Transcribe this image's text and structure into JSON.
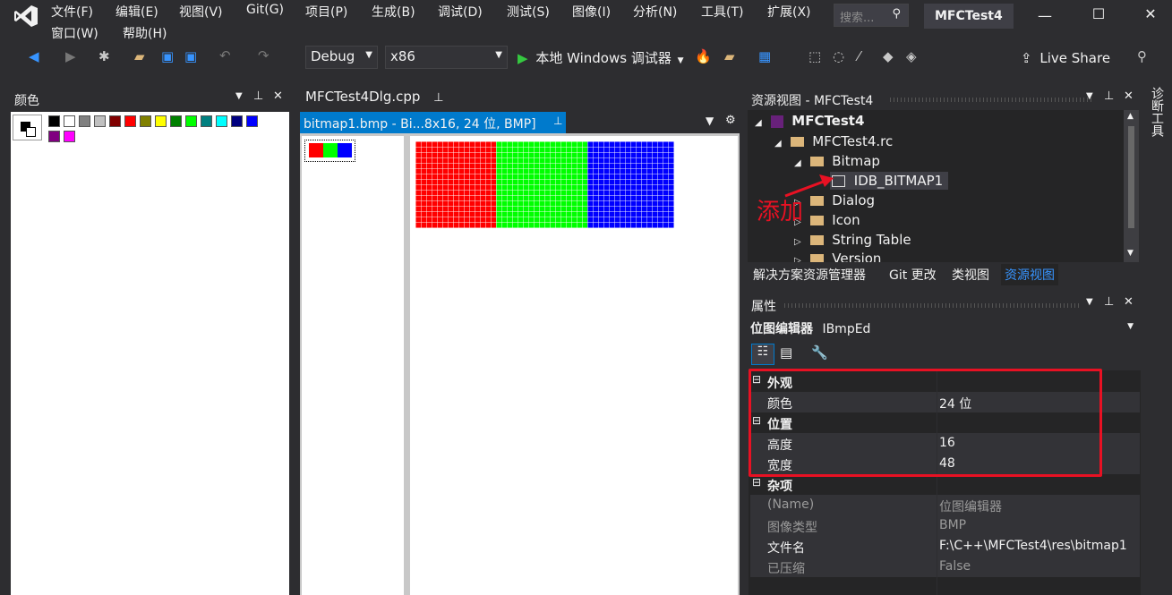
{
  "menu": {
    "items": [
      "文件(F)",
      "编辑(E)",
      "视图(V)",
      "Git(G)",
      "项目(P)",
      "生成(B)",
      "调试(D)",
      "测试(S)",
      "图像(I)",
      "分析(N)",
      "工具(T)",
      "扩展(X)"
    ],
    "items2": [
      "窗口(W)",
      "帮助(H)"
    ],
    "search_placeholder": "搜索...",
    "solution_title": "MFCTest4"
  },
  "toolbar": {
    "config": "Debug",
    "platform": "x86",
    "run_label": "本地 Windows 调试器",
    "live_share": "Live Share"
  },
  "colors_panel": {
    "title": "颜色",
    "palette": [
      "#000000",
      "#ffffff",
      "#808080",
      "#c0c0c0",
      "#800000",
      "#ff0000",
      "#808000",
      "#ffff00",
      "#008000",
      "#00ff00",
      "#008080",
      "#00ffff",
      "#000080",
      "#0000ff",
      "#800080",
      "#ff00ff"
    ]
  },
  "editor": {
    "tab_pinned": "MFCTest4Dlg.cpp",
    "tab_active": "bitmap1.bmp - Bi...8x16, 24 位, BMP]",
    "bitmap_colors": [
      "#ff0000",
      "#00ff00",
      "#0000ff"
    ]
  },
  "resource_view": {
    "title": "资源视图 - MFCTest4",
    "tree": {
      "root": "MFCTest4",
      "rc": "MFCTest4.rc",
      "bitmap": "Bitmap",
      "idb": "IDB_BITMAP1",
      "dialog": "Dialog",
      "icon": "Icon",
      "string_table": "String Table",
      "version": "Version"
    },
    "annotation": "添加",
    "tabs": [
      "解决方案资源管理器",
      "Git 更改",
      "类视图",
      "资源视图"
    ]
  },
  "properties": {
    "title": "属性",
    "object_name": "位图编辑器",
    "object_type": "IBmpEd",
    "cat_appearance": "外观",
    "color_label": "颜色",
    "color_value": "24 位",
    "cat_position": "位置",
    "height_label": "高度",
    "height_value": "16",
    "width_label": "宽度",
    "width_value": "48",
    "cat_misc": "杂项",
    "name_label": "(Name)",
    "name_value": "位图编辑器",
    "imgtype_label": "图像类型",
    "imgtype_value": "BMP",
    "filename_label": "文件名",
    "filename_value": "F:\\C++\\MFCTest4\\res\\bitmap1",
    "compressed_label": "已压缩",
    "compressed_value": "False"
  },
  "side_tab": "诊断工具",
  "accent": "#007acc",
  "highlight_red": "#e81123"
}
